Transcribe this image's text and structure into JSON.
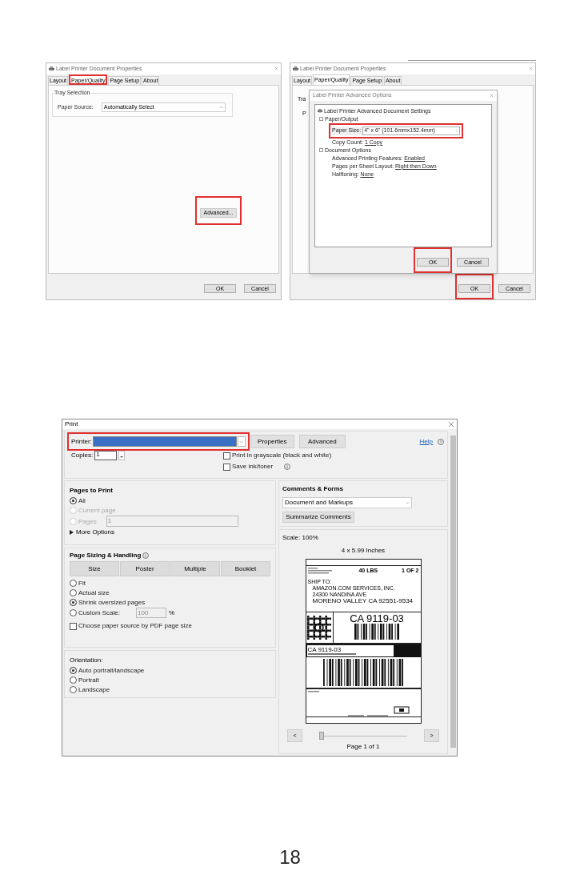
{
  "properties_window": {
    "title": "Label Printer Document Properties",
    "tabs": [
      {
        "label": "Layout",
        "selected": false,
        "highlighted": false
      },
      {
        "label": "Paper/Quality",
        "selected": true,
        "highlighted": true
      },
      {
        "label": "Page Setup",
        "selected": false,
        "highlighted": false
      },
      {
        "label": "About",
        "selected": false,
        "highlighted": false
      }
    ],
    "group_title": "Tray Selection",
    "paper_source_label": "Paper Source:",
    "paper_source_value": "Automatically Select",
    "advanced_button": {
      "label": "Advanced...",
      "highlighted": true
    },
    "buttons": [
      {
        "label": "OK",
        "highlighted": false
      },
      {
        "label": "Cancel",
        "highlighted": false
      }
    ]
  },
  "advanced_window": {
    "title": "Label Printer Document Properties",
    "tabs": [
      {
        "label": "Layout",
        "selected": false
      },
      {
        "label": "Paper/Quality",
        "selected": true
      },
      {
        "label": "Page Setup",
        "selected": false
      },
      {
        "label": "About",
        "selected": false
      }
    ],
    "hidden_group_title": "Tra",
    "hidden_label": "P",
    "buttons": [
      {
        "label": "OK",
        "highlighted": true
      },
      {
        "label": "Cancel",
        "highlighted": false
      }
    ],
    "options_dialog": {
      "title": "Label Printer Advanced Options",
      "root": "Label Printer Advanced Document Settings",
      "paper_output": "Paper/Output",
      "paper_size_label": "Paper Size:",
      "paper_size_value": "4\" x 6\" (101.6mmx152.4mm)",
      "paper_size_highlighted": true,
      "copy_count_label": "Copy Count:",
      "copy_count_value": "1 Copy",
      "document_options": "Document Options",
      "settings": [
        {
          "label": "Advanced Printing Features:",
          "value": "Enabled"
        },
        {
          "label": "Pages per Sheet Layout:",
          "value": "Right then Down"
        },
        {
          "label": "Halftoning:",
          "value": "None"
        }
      ],
      "buttons": [
        {
          "label": "OK",
          "highlighted": true
        },
        {
          "label": "Cancel",
          "highlighted": false
        }
      ]
    }
  },
  "print_dialog": {
    "title": "Print",
    "printer_label": "Printer:",
    "printer_highlighted": true,
    "properties_button": "Properties",
    "advanced_button": "Advanced",
    "help_link": "Help",
    "copies_label": "Copies:",
    "copies_value": "1",
    "options": [
      {
        "label": "Print in grayscale (black and white)",
        "checked": false
      },
      {
        "label": "Save ink/toner",
        "checked": false
      }
    ],
    "pages_to_print": {
      "title": "Pages to Print",
      "radios": [
        {
          "label": "All",
          "selected": true,
          "disabled": false
        },
        {
          "label": "Current page",
          "selected": false,
          "disabled": true
        },
        {
          "label": "Pages",
          "selected": false,
          "disabled": true
        }
      ],
      "pages_value": "1",
      "more_options": "More Options"
    },
    "page_sizing": {
      "title": "Page Sizing & Handling",
      "tabs": [
        "Size",
        "Poster",
        "Multiple",
        "Booklet"
      ],
      "radios": [
        {
          "label": "Fit",
          "selected": false
        },
        {
          "label": "Actual size",
          "selected": false
        },
        {
          "label": "Shrink oversized pages",
          "selected": true
        },
        {
          "label": "Custom Scale:",
          "selected": false
        }
      ],
      "scale_value": "100",
      "percent": "%",
      "paper_source_option": {
        "label": "Choose paper source by PDF page size",
        "checked": false
      }
    },
    "orientation": {
      "title": "Orientation:",
      "radios": [
        {
          "label": "Auto portrait/landscape",
          "selected": true
        },
        {
          "label": "Portrait",
          "selected": false
        },
        {
          "label": "Landscape",
          "selected": false
        }
      ]
    },
    "comments": {
      "title": "Comments & Forms",
      "value": "Document and Markups",
      "button": "Summarize Comments"
    },
    "preview": {
      "scale": "Scale: 100%",
      "size": "4 x 5.99 Inches",
      "label": {
        "weight": "40 LBS",
        "count": "1 OF 2",
        "ship_to": "SHIP TO:",
        "company": "AMAZON.COM SERVICES, INC.",
        "street": "24300 NANDINA AVE",
        "city": "MORENO VALLEY CA 92551-9534",
        "code": "CA 9119-03",
        "code_repeat": "CA 9119-03"
      },
      "prev": "<",
      "next": ">",
      "slider": {
        "level": 0
      },
      "page": "Page 1 of 1"
    }
  },
  "page_number": "18"
}
